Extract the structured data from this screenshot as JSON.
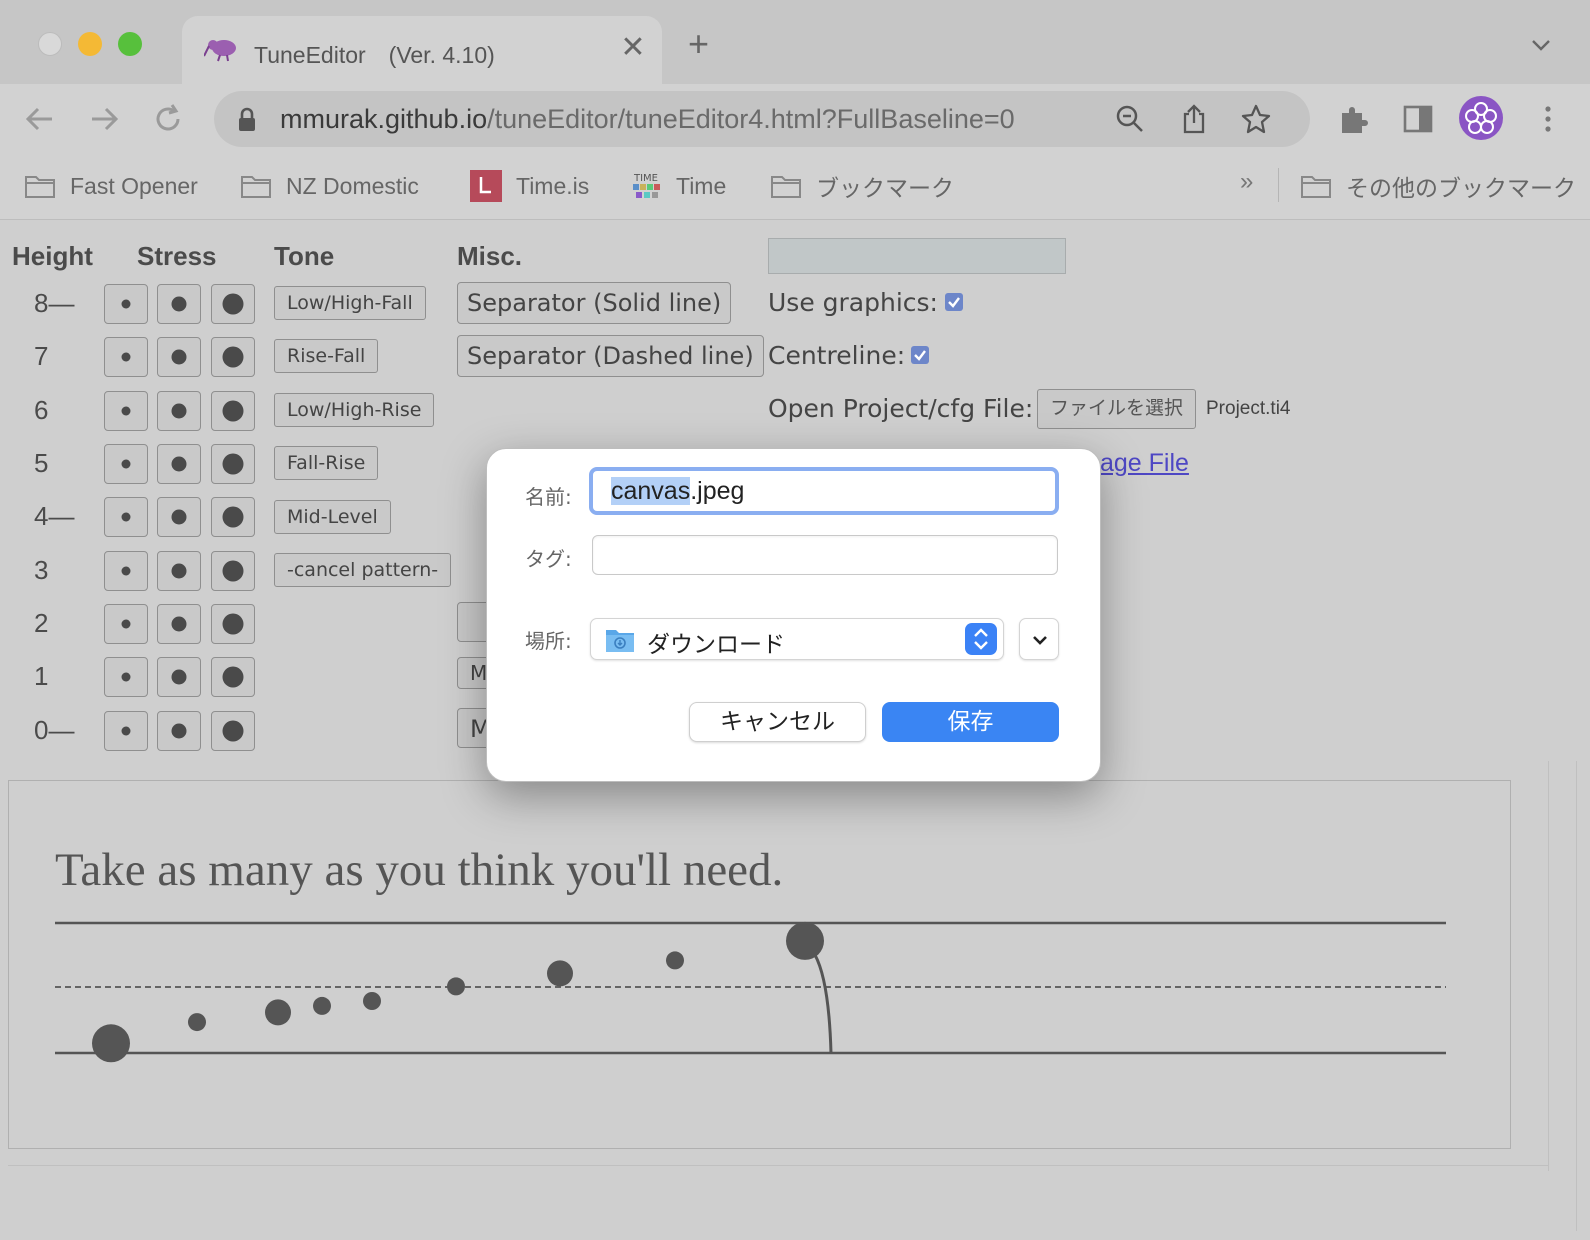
{
  "browser": {
    "tab_title": "TuneEditor　(Ver. 4.10)",
    "close_glyph": "✕",
    "newtab_glyph": "+",
    "url_host": "mmurak.github.io",
    "url_path": "/tuneEditor/tuneEditor4.html?FullBaseline=0",
    "icons": [
      "back-icon",
      "forward-icon",
      "reload-icon",
      "lock-icon",
      "zoom-icon",
      "share-icon",
      "star-icon",
      "extensions-icon",
      "sidepanel-icon",
      "profile-avatar",
      "menu-icon"
    ]
  },
  "bookmarks": {
    "items": [
      {
        "label": "Fast Opener"
      },
      {
        "label": "NZ Domestic"
      },
      {
        "label": "Time.is"
      },
      {
        "label": "Time"
      },
      {
        "label": "ブックマーク"
      }
    ],
    "overflow": "»",
    "other": "その他のブックマーク",
    "favicon_time_text": "TIME"
  },
  "editor": {
    "headers": {
      "height": "Height",
      "stress": "Stress",
      "tone": "Tone",
      "misc": "Misc."
    },
    "heights": [
      "8—",
      "7",
      "6",
      "5",
      "4—",
      "3",
      "2",
      "1",
      "0—"
    ],
    "tone_buttons": [
      "Low/High-Fall",
      "Rise-Fall",
      "Low/High-Rise",
      "Fall-Rise",
      "Mid-Level",
      "-cancel pattern-"
    ],
    "misc_buttons": [
      "Separator (Solid line)",
      "Separator (Dashed line)"
    ],
    "misc_partial": [
      "M",
      "M"
    ],
    "use_graphics_label": "Use graphics:",
    "use_graphics_checked": true,
    "centreline_label": "Centreline:",
    "centreline_checked": true,
    "open_project_label": "Open Project/cfg File:",
    "file_button": "ファイルを選択",
    "file_name": "Project.ti4",
    "partial_link": "age File",
    "text_input_value": ""
  },
  "canvas": {
    "sentence": "Take as many as you think you'll need.",
    "dots": [
      {
        "level": 0.3,
        "size": "large"
      },
      {
        "level": 0.95,
        "size": "small"
      },
      {
        "level": 1.25,
        "size": "medium"
      },
      {
        "level": 1.45,
        "size": "small"
      },
      {
        "level": 1.6,
        "size": "small"
      },
      {
        "level": 2.05,
        "size": "small"
      },
      {
        "level": 2.45,
        "size": "medium"
      },
      {
        "level": 2.85,
        "size": "small"
      },
      {
        "level": 3.45,
        "size": "large",
        "fall": true
      }
    ]
  },
  "dialog": {
    "name_label": "名前:",
    "name_selected": "canvas",
    "name_rest": ".jpeg",
    "tag_label": "タグ:",
    "tag_value": "",
    "location_label": "場所:",
    "location_value": "ダウンロード",
    "cancel_label": "キャンセル",
    "save_label": "保存",
    "accent_color": "#3a85f3"
  }
}
